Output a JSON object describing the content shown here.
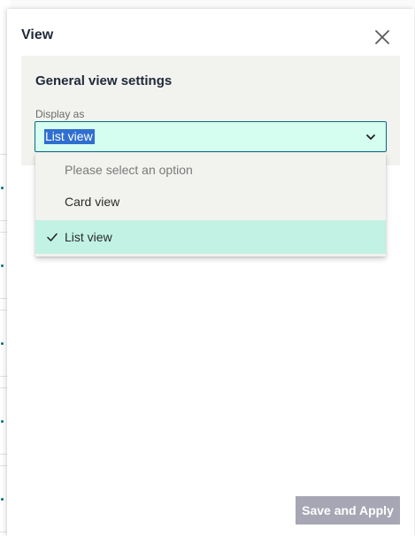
{
  "panel": {
    "title": "View",
    "close_icon": "close-icon"
  },
  "general_settings": {
    "title": "General view settings",
    "display_as": {
      "label": "Display as",
      "selected_value": "List view",
      "options": [
        {
          "label": "Please select an option",
          "placeholder": true
        },
        {
          "label": "Card view",
          "selected": false
        },
        {
          "label": "List view",
          "selected": true
        }
      ]
    }
  },
  "footer": {
    "save_label": "Save and Apply",
    "save_disabled": true
  },
  "colors": {
    "accent": "#0a6a82",
    "select_bg": "#d5fdf0",
    "selected_option_bg": "#c1f2e4",
    "card_bg": "#f2f2ef",
    "disabled_button": "#a6a6b4"
  }
}
